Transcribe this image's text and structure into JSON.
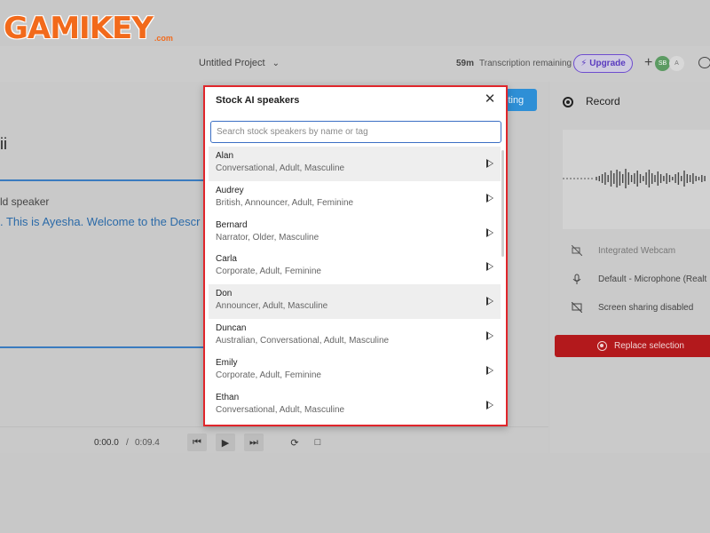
{
  "watermark": {
    "logo_text": "GAMIKEY",
    "domain": ".com"
  },
  "topbar": {
    "project_title": "Untitled Project",
    "minutes": "59m",
    "transcription_remaining": "Transcription remaining",
    "upgrade_label": "Upgrade",
    "avatar1": "SB",
    "avatar2": "A"
  },
  "editor": {
    "title_fragment": "ii",
    "speaker_fragment": "ld speaker",
    "transcript_fragment": ". This is Ayesha. Welcome to the Descr",
    "edit_button_fragment": "iting",
    "player": {
      "current_time": "0:00.0",
      "separator": "/",
      "total_time": "0:09.4"
    }
  },
  "record_panel": {
    "title": "Record",
    "webcam": "Integrated Webcam",
    "microphone": "Default - Microphone (Realt",
    "screen_sharing": "Screen sharing disabled",
    "replace_button": "Replace selection"
  },
  "modal": {
    "title": "Stock AI speakers",
    "search_placeholder": "Search stock speakers by name or tag",
    "speakers": [
      {
        "name": "Alan",
        "tags": "Conversational, Adult, Masculine",
        "highlighted": true
      },
      {
        "name": "Audrey",
        "tags": "British, Announcer, Adult, Feminine",
        "highlighted": false
      },
      {
        "name": "Bernard",
        "tags": "Narrator, Older, Masculine",
        "highlighted": false
      },
      {
        "name": "Carla",
        "tags": "Corporate, Adult, Feminine",
        "highlighted": false
      },
      {
        "name": "Don",
        "tags": "Announcer, Adult, Masculine",
        "highlighted": true
      },
      {
        "name": "Duncan",
        "tags": "Australian, Conversational, Adult, Masculine",
        "highlighted": false
      },
      {
        "name": "Emily",
        "tags": "Corporate, Adult, Feminine",
        "highlighted": false
      },
      {
        "name": "Ethan",
        "tags": "Conversational, Adult, Masculine",
        "highlighted": false
      }
    ]
  },
  "colors": {
    "modal_border": "#e0262b",
    "search_focus": "#3b6fc4",
    "upgrade_accent": "#6e4ccf",
    "replace_button": "#b3191c",
    "transcript_text": "#2b6aa8"
  }
}
